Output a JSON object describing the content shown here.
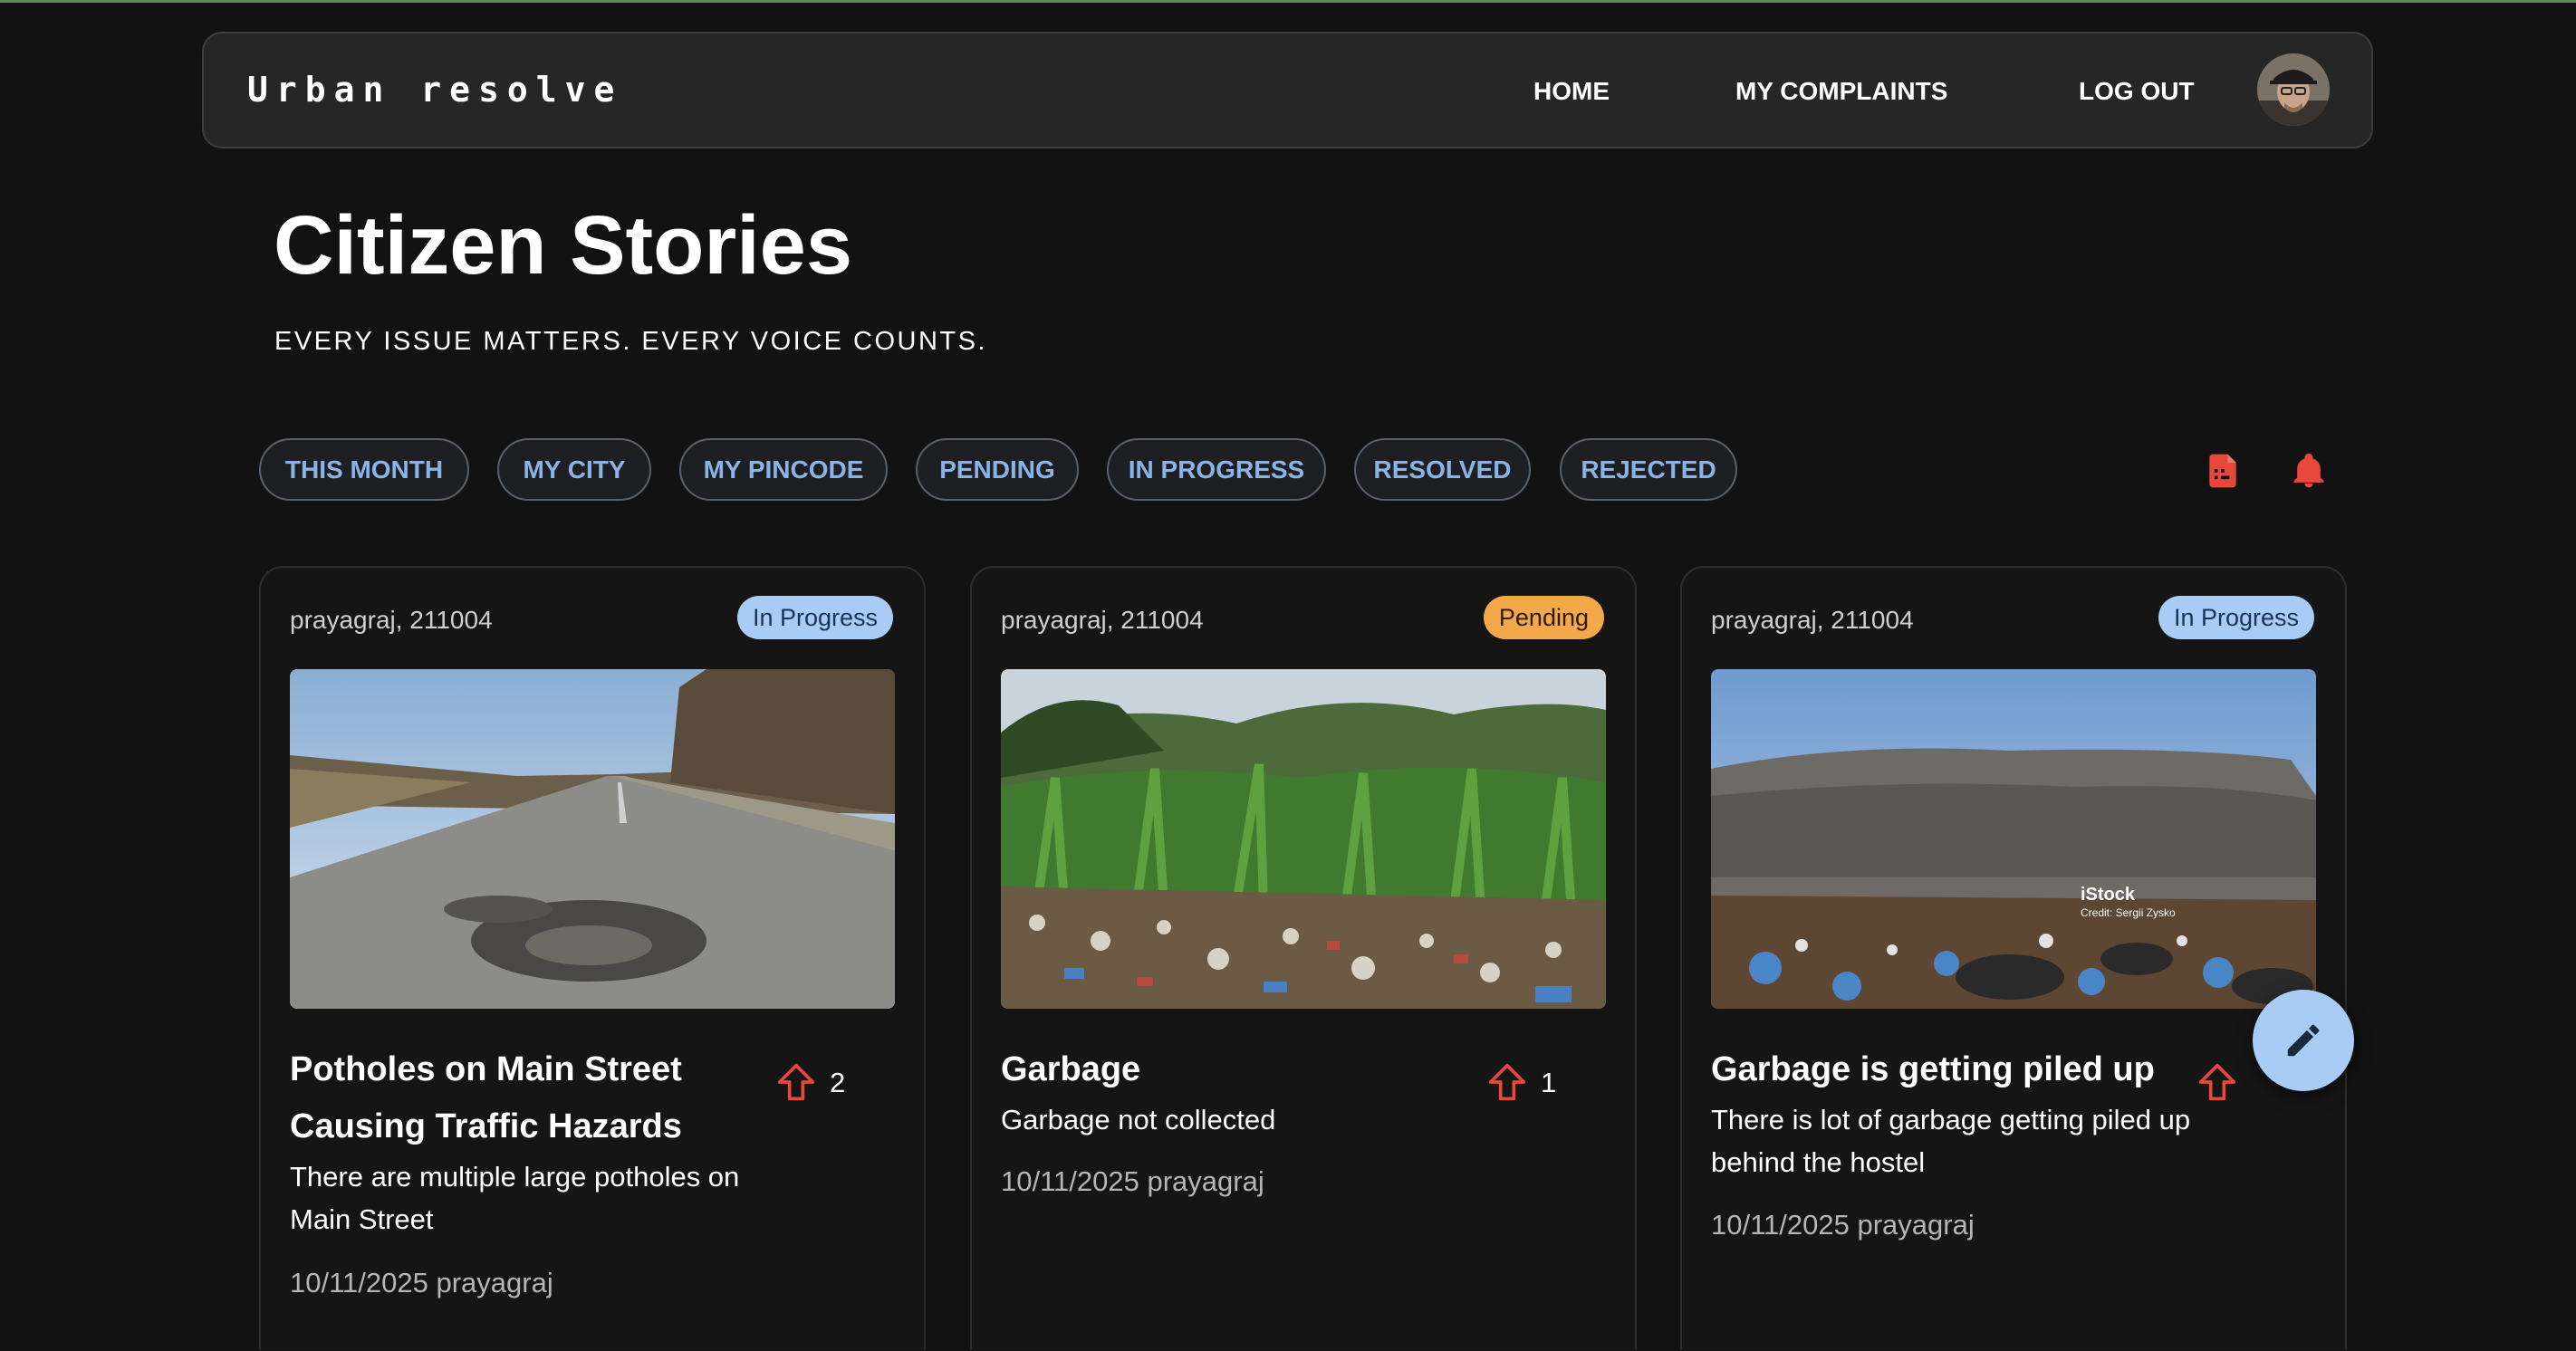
{
  "navbar": {
    "brand": "Urban resolve",
    "links": [
      "HOME",
      "MY COMPLAINTS",
      "LOG OUT"
    ]
  },
  "header": {
    "title": "Citizen Stories",
    "subtitle": "EVERY ISSUE MATTERS. EVERY VOICE COUNTS."
  },
  "filters": [
    "THIS MONTH",
    "MY CITY",
    "MY PINCODE",
    "PENDING",
    "IN PROGRESS",
    "RESOLVED",
    "REJECTED"
  ],
  "toolbar_icons": [
    "report-icon",
    "bell-icon"
  ],
  "cards": [
    {
      "location": "prayagraj, 211004",
      "status": "In Progress",
      "title": "Potholes on Main Street Causing Traffic Hazards",
      "description": "There are multiple large potholes on Main Street",
      "date_city": "10/11/2025 prayagraj",
      "upvotes": "2"
    },
    {
      "location": "prayagraj, 211004",
      "status": "Pending",
      "title": "Garbage",
      "description": "Garbage not collected",
      "date_city": "10/11/2025 prayagraj",
      "upvotes": "1"
    },
    {
      "location": "prayagraj, 211004",
      "status": "In Progress",
      "title": "Garbage is getting piled up",
      "description": "There is lot of garbage getting piled up behind the hostel",
      "date_city": "10/11/2025 prayagraj",
      "image_watermark": "iStock",
      "image_credit": "Credit: Sergii Zysko"
    }
  ],
  "colors": {
    "background": "#121212",
    "accent": "#8ab4e8",
    "alert": "#e8473c",
    "in_progress": "#a8ccf5",
    "pending": "#f3a94a"
  }
}
